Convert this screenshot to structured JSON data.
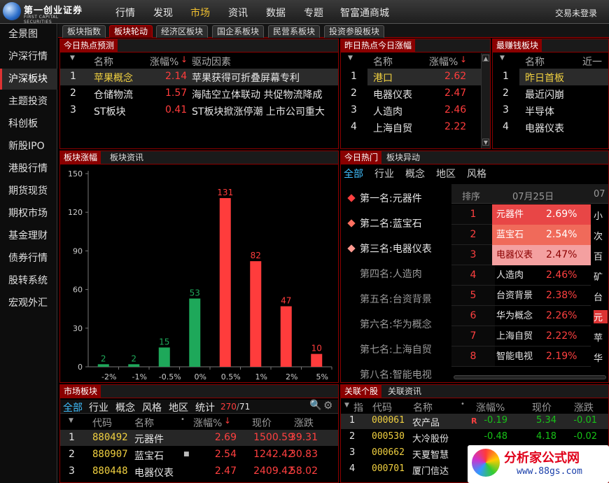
{
  "app": {
    "logo_cn": "第一创业证券",
    "logo_en": "FIRST CAPITAL SECURITIES",
    "menu": [
      "行情",
      "发现",
      "市场",
      "资讯",
      "数据",
      "专题",
      "智富通商城"
    ],
    "login": "交易未登录"
  },
  "sidebar": {
    "items": [
      "全景图",
      "沪深行情",
      "沪深板块",
      "主题投资",
      "科创板",
      "新股IPO",
      "港股行情",
      "期货现货",
      "期权市场",
      "基金理财",
      "债券行情",
      "股转系统",
      "宏观外汇"
    ]
  },
  "tabs": [
    "板块指数",
    "板块轮动",
    "经济区板块",
    "国企系板块",
    "民营系板块",
    "投资参股板块"
  ],
  "panel_hot_forecast": {
    "title": "今日热点预测",
    "cols": [
      "名称",
      "涨幅%",
      "驱动因素"
    ],
    "rows": [
      {
        "idx": "1",
        "name": "苹果概念",
        "pct": "2.14",
        "reason": "苹果获得可折叠屏幕专利"
      },
      {
        "idx": "2",
        "name": "仓储物流",
        "pct": "1.57",
        "reason": "海陆空立体联动 共促物流降成"
      },
      {
        "idx": "3",
        "name": "ST板块",
        "pct": "0.41",
        "reason": "ST板块掀涨停潮 上市公司重大"
      }
    ]
  },
  "panel_yesterday": {
    "title": "昨日热点今日涨幅",
    "cols": [
      "名称",
      "涨幅%"
    ],
    "rows": [
      {
        "idx": "1",
        "name": "港口",
        "pct": "2.62"
      },
      {
        "idx": "2",
        "name": "电器仪表",
        "pct": "2.47"
      },
      {
        "idx": "3",
        "name": "人造肉",
        "pct": "2.46"
      },
      {
        "idx": "4",
        "name": "上海自贸",
        "pct": "2.22"
      }
    ]
  },
  "panel_money": {
    "title": "最赚钱板块",
    "cols": [
      "名称",
      "近一"
    ],
    "rows": [
      {
        "idx": "1",
        "name": "昨日首板"
      },
      {
        "idx": "2",
        "name": "最近闪崩"
      },
      {
        "idx": "3",
        "name": "半导体"
      },
      {
        "idx": "4",
        "name": "电器仪表"
      }
    ]
  },
  "panel_chart": {
    "tabs": [
      "板块涨幅",
      "板块资讯"
    ]
  },
  "chart_data": {
    "type": "bar",
    "categories": [
      "-2%",
      "-1%",
      "-0.5%",
      "0%",
      "0.5%",
      "1%",
      "2%",
      "5%"
    ],
    "values": [
      2,
      2,
      15,
      53,
      131,
      82,
      47,
      10
    ],
    "bar_colors": [
      "#1ea85a",
      "#1ea85a",
      "#1ea85a",
      "#1ea85a",
      "#ff3c3c",
      "#ff3c3c",
      "#ff3c3c",
      "#ff3c3c"
    ],
    "ylim": [
      0,
      150
    ],
    "yticks": [
      0,
      30,
      60,
      90,
      120,
      150
    ],
    "grid": false
  },
  "panel_hot_today": {
    "tabs": [
      "今日热门",
      "板块异动"
    ],
    "filters": [
      "全部",
      "行业",
      "概念",
      "地区",
      "风格"
    ],
    "ranks": [
      "第一名:元器件",
      "第二名:蓝宝石",
      "第三名:电器仪表",
      "第四名:人造肉",
      "第五名:台资背景",
      "第六名:华为概念",
      "第七名:上海自贸",
      "第八名:智能电视"
    ],
    "table_head": {
      "rank": "排序",
      "date": "07月25日",
      "next": "07"
    },
    "rows": [
      {
        "rank": "1",
        "name": "元器件",
        "pct": "2.69%",
        "next": "小"
      },
      {
        "rank": "2",
        "name": "蓝宝石",
        "pct": "2.54%",
        "next": "次"
      },
      {
        "rank": "3",
        "name": "电器仪表",
        "pct": "2.47%",
        "next": "百"
      },
      {
        "rank": "4",
        "name": "人造肉",
        "pct": "2.46%",
        "next": "矿"
      },
      {
        "rank": "5",
        "name": "台资背景",
        "pct": "2.38%",
        "next": "台"
      },
      {
        "rank": "6",
        "name": "华为概念",
        "pct": "2.26%",
        "next": "元"
      },
      {
        "rank": "7",
        "name": "上海自贸",
        "pct": "2.22%",
        "next": "苹"
      },
      {
        "rank": "8",
        "name": "智能电视",
        "pct": "2.19%",
        "next": "华"
      }
    ]
  },
  "panel_market": {
    "title": "市场板块",
    "filters": [
      "全部",
      "行业",
      "概念",
      "风格",
      "地区",
      "统计"
    ],
    "count": "270",
    "total": "71",
    "cols": [
      "代码",
      "名称",
      "涨幅%",
      "现价",
      "涨跌"
    ],
    "rows": [
      {
        "idx": "1",
        "code": "880492",
        "name": "元器件",
        "pct": "2.69",
        "price": "1500.59",
        "chg": "39.31"
      },
      {
        "idx": "2",
        "code": "880907",
        "name": "蓝宝石",
        "pct": "2.54",
        "price": "1242.42",
        "chg": "30.83"
      },
      {
        "idx": "3",
        "code": "880448",
        "name": "电器仪表",
        "pct": "2.47",
        "price": "2409.42",
        "chg": "58.02"
      }
    ]
  },
  "panel_related": {
    "tabs": [
      "关联个股",
      "关联资讯"
    ],
    "cols": [
      "指",
      "代码",
      "名称",
      "涨幅%",
      "现价",
      "涨跌"
    ],
    "rows": [
      {
        "idx": "1",
        "code": "000061",
        "name": "农产品",
        "tag": "R",
        "pct": "-0.19",
        "price": "5.34",
        "chg": "-0.01"
      },
      {
        "idx": "2",
        "code": "000530",
        "name": "大冷股份",
        "pct": "-0.48",
        "price": "4.18",
        "chg": "-0.02"
      },
      {
        "idx": "3",
        "code": "000662",
        "name": "天夏智慧",
        "pct": "",
        "price": "",
        "chg": ""
      },
      {
        "idx": "4",
        "code": "000701",
        "name": "厦门信达",
        "pct": "",
        "price": "",
        "chg": ""
      }
    ]
  },
  "watermark": {
    "text": "分析家公式网",
    "url": "www.88gs.com"
  }
}
